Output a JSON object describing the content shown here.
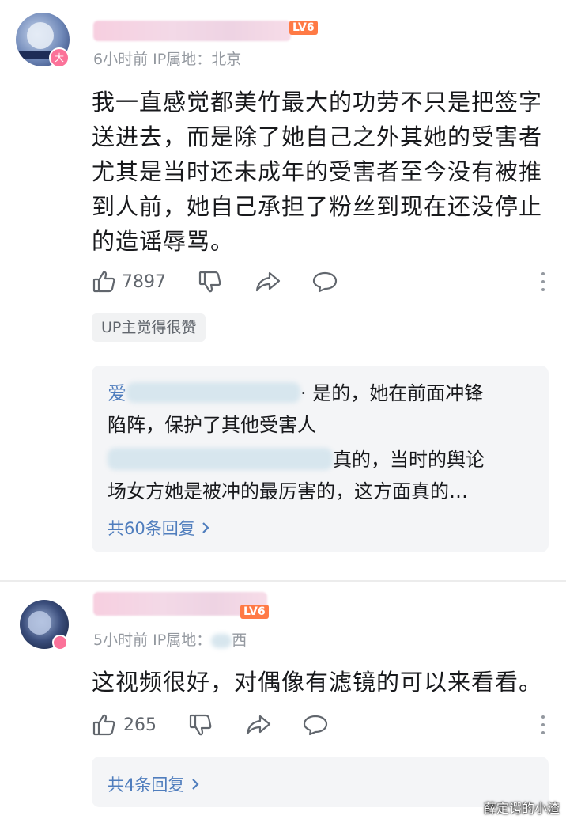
{
  "comments": [
    {
      "avatar_badge": "大",
      "level": "LV6",
      "time": "6小时前",
      "ip": "IP属地：北京",
      "content": "我一直感觉都美竹最大的功劳不只是把签字送进去，而是除了她自己之外其她的受害者尤其是当时还未成年的受害者至今没有被推到人前，她自己承担了粉丝到现在还没停止的造谣辱骂。",
      "likes": "7897",
      "up_tag": "UP主觉得很赞",
      "replies": [
        {
          "name": "爱",
          "text": "是的，她在前面冲锋陷阵，保护了其他受害人"
        },
        {
          "name": "",
          "text": "真的，当时的舆论场女方她是被冲的最厉害的，这方面真的…"
        }
      ],
      "reply_count": "共60条回复",
      "reply_line_2a": "陷阵，保护了其他受害人",
      "reply_line_1a": "· 是的，她在前面冲锋",
      "reply_line_3a": "真的，当时的舆论",
      "reply_line_4a": "场女方她是被冲的最厉害的，这方面真的…"
    },
    {
      "avatar_badge": "",
      "level": "LV6",
      "time": "5小时前",
      "ip": "IP属地：",
      "ip_tail": "西",
      "content": "这视频很好，对偶像有滤镜的可以来看看。",
      "likes": "265",
      "reply_count": "共4条回复"
    }
  ],
  "icons": [
    "thumb-up-icon",
    "thumb-down-icon",
    "share-icon",
    "reply-bubble-icon",
    "more-icon",
    "chevron-right-icon"
  ],
  "colors": {
    "link": "#4f7dbd",
    "meta": "#9499a0",
    "badge": "#fb7299",
    "level": "#ff7a45"
  },
  "watermark": "薛定谔的小渣"
}
